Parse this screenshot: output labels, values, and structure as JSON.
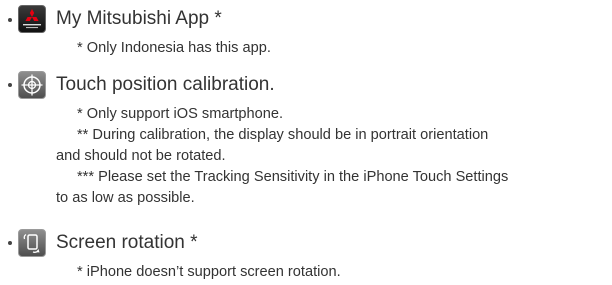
{
  "items": [
    {
      "title": "My Mitsubishi App *",
      "icon": "mitsubishi-app-icon",
      "icon_text": "MITSUBISHI MOTORS",
      "notes": [
        "* Only Indonesia has this app."
      ]
    },
    {
      "title": "Touch position calibration.",
      "icon": "crosshair-icon",
      "notes": [
        "* Only support iOS smartphone.",
        "** During calibration, the display should be in portrait orientation",
        "and should not be rotated.",
        "*** Please set the Tracking Sensitivity in the iPhone Touch Settings",
        "to as low as possible."
      ]
    },
    {
      "title": "Screen rotation *",
      "icon": "screen-rotation-icon",
      "notes": [
        "* iPhone doesn’t support screen rotation."
      ]
    }
  ],
  "colors": {
    "text": "#333333",
    "mitsubishi_red": "#e60012",
    "icon_gray": "#6b6b6b"
  }
}
